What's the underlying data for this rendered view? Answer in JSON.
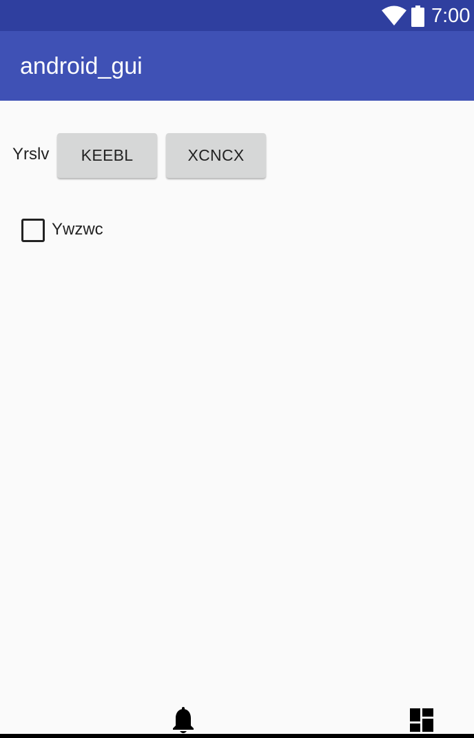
{
  "status_bar": {
    "time": "7:00",
    "icons": [
      "wifi-icon",
      "battery-icon"
    ]
  },
  "app_bar": {
    "title": "android_gui"
  },
  "content": {
    "row_label": "Yrslv",
    "buttons": [
      {
        "label": "KEEBL"
      },
      {
        "label": "XCNCX"
      }
    ],
    "checkbox": {
      "label": "Ywzwc",
      "checked": false
    }
  },
  "bottom_icons": [
    "bell-icon",
    "dashboard-icon"
  ],
  "colors": {
    "status_bar": "#2f3f9f",
    "app_bar": "#3f51b5",
    "background": "#fafafa",
    "button": "#d6d7d7"
  }
}
